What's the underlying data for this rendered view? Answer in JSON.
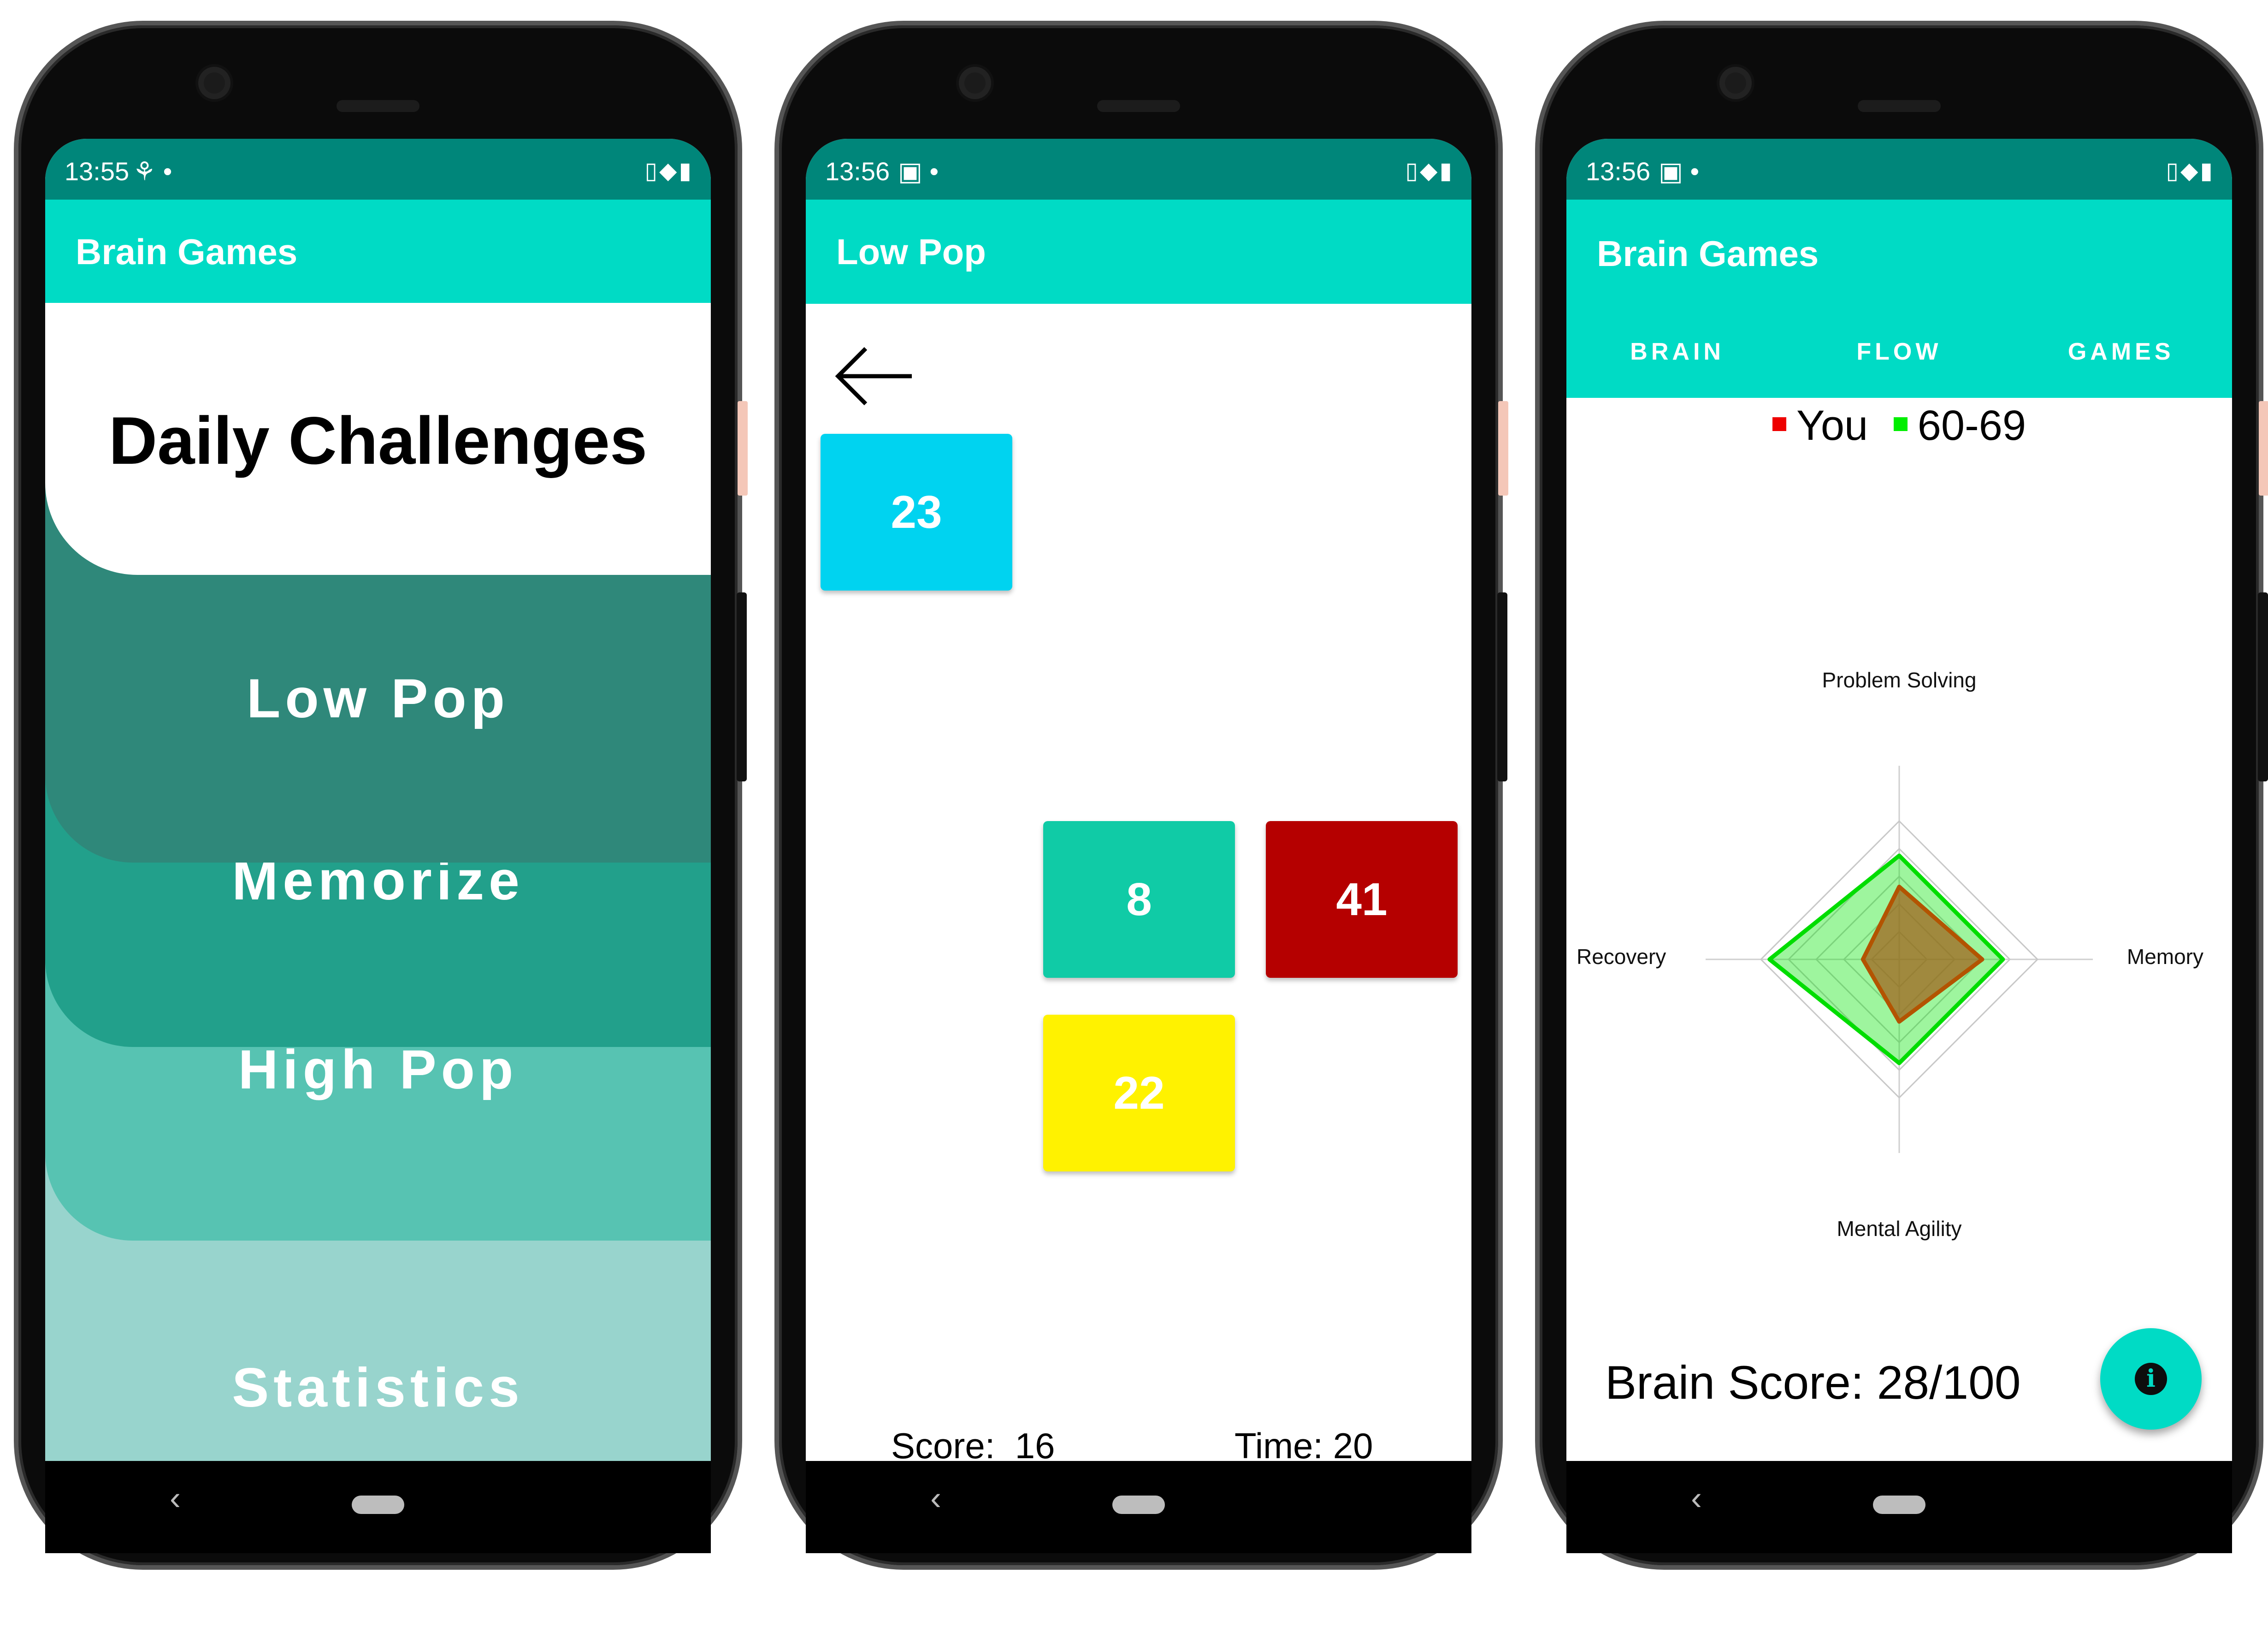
{
  "colors": {
    "status_bar": "#00867a",
    "app_bar": "#00dbc5",
    "low_pop_card": "#2f887a",
    "memorize_card": "#22a08b",
    "high_pop_card": "#57c3b2",
    "statistics_card": "#98d4cd",
    "tile_cyan": "#00d3f0",
    "tile_teal": "#10cba6",
    "tile_red": "#b50000",
    "tile_yellow": "#fff200",
    "legend_you": "#ee0000",
    "legend_avg": "#00ee00"
  },
  "phone1": {
    "status": {
      "time": "13:55",
      "left_icons": "⚘ •",
      "right_icons": "▯◆▮"
    },
    "appbar_title": "Brain Games",
    "daily_title": "Daily Challenges",
    "menu": [
      {
        "label": "Low Pop"
      },
      {
        "label": "Memorize"
      },
      {
        "label": "High Pop"
      },
      {
        "label": "Statistics"
      }
    ],
    "nav": {
      "back": "‹"
    }
  },
  "phone2": {
    "status": {
      "time": "13:56",
      "left_icons": "▣ •",
      "right_icons": "▯◆▮"
    },
    "appbar_title": "Low Pop",
    "back_arrow_icon": "arrow-left-icon",
    "tiles": [
      {
        "value": "23",
        "color": "#00d3f0"
      },
      {
        "value": "8",
        "color": "#10cba6"
      },
      {
        "value": "41",
        "color": "#b50000"
      },
      {
        "value": "22",
        "color": "#fff200"
      }
    ],
    "score_text": "Score:  16",
    "time_text": "Time: 20",
    "nav": {
      "back": "‹"
    }
  },
  "phone3": {
    "status": {
      "time": "13:56",
      "left_icons": "▣ •",
      "right_icons": "▯◆▮"
    },
    "appbar_title": "Brain Games",
    "tabs": [
      "BRAIN",
      "FLOW",
      "GAMES"
    ],
    "legend": [
      {
        "label": "You",
        "color": "#ee0000"
      },
      {
        "label": "60-69",
        "color": "#00ee00"
      }
    ],
    "brain_score": "Brain Score: 28/100",
    "fab_icon": "info-icon",
    "fab_glyph": "i",
    "nav": {
      "back": "‹"
    },
    "chart_data": {
      "type": "radar",
      "axes": [
        "Problem Solving",
        "Memory",
        "Mental Agility",
        "Recovery"
      ],
      "max": 100,
      "rings": 5,
      "series": [
        {
          "name": "You",
          "values": [
            28,
            32,
            24,
            14
          ],
          "stroke": "#b35400",
          "fill": "rgba(160,100,30,0.75)"
        },
        {
          "name": "60-69",
          "values": [
            40,
            40,
            40,
            50
          ],
          "stroke": "#00dd00",
          "fill": "rgba(0,230,0,0.38)"
        }
      ]
    }
  }
}
